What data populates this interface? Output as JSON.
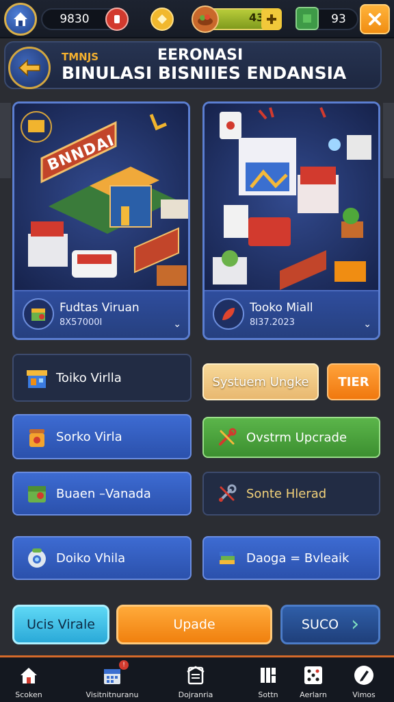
{
  "top_bar": {
    "coins": "9830",
    "energy": "43",
    "gems": "93"
  },
  "header": {
    "small_label": "TMNJS",
    "super_label": "EERONASI",
    "title": "BINULASI  BISNIIES ENDANSIA"
  },
  "cards": [
    {
      "sign": "BNNDAI",
      "name": "Fudtas Viruan",
      "sub": "8X57000I",
      "chevron": "⌄"
    },
    {
      "name": "Tooko Miall",
      "sub": "8I37.2023",
      "chevron": "⌄"
    }
  ],
  "buttons": {
    "left": [
      {
        "label": "Toiko Virlla",
        "icon": "shop-icon"
      },
      {
        "label": "Sorko Virla",
        "icon": "jar-icon"
      },
      {
        "label": "Buaen –Vanada",
        "icon": "crate-icon"
      },
      {
        "label": "Doiko Vhila",
        "icon": "robot-icon"
      }
    ],
    "right": [
      {
        "label": "Systuem Ungke"
      },
      {
        "label": "TIER"
      },
      {
        "label": "Ovstrm Upcrade",
        "icon": "tools-icon"
      },
      {
        "label": "Sonte Hlerad",
        "icon": "wrench-icon"
      },
      {
        "label": "Daoga = Bvleaik",
        "icon": "stack-icon"
      }
    ]
  },
  "bottom_actions": {
    "left": "Ucis Virale",
    "middle": "Upade",
    "right": "SUCO",
    "right_arrow": "›"
  },
  "nav": {
    "items": [
      {
        "label": "Scoken",
        "icon": "home-icon"
      },
      {
        "label": "Visitnitnuranu",
        "icon": "calendar-icon",
        "badge": "!"
      },
      {
        "label": "Dojranria",
        "icon": "document-icon"
      },
      {
        "label": "Sottn",
        "icon": "grid-icon"
      },
      {
        "label": "Aerlarn",
        "icon": "dice-icon"
      },
      {
        "label": "Vimos",
        "icon": "pen-icon"
      }
    ]
  },
  "colors": {
    "accent_orange": "#f08d12",
    "accent_green": "#4fa83a",
    "panel_blue": "#2b51ac",
    "gold": "#d9b04a"
  }
}
